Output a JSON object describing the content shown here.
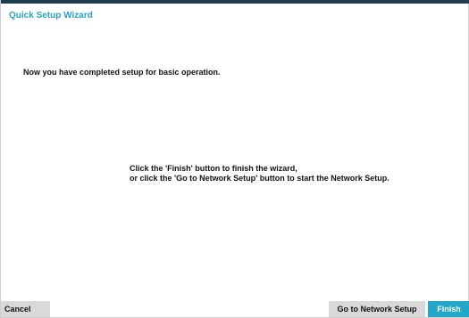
{
  "window": {
    "title": "Quick Setup Wizard"
  },
  "content": {
    "headline": "Now you have completed setup for basic operation.",
    "instruction_lines": [
      "Click the 'Finish' button to finish the wizard,",
      "or click the 'Go to Network Setup' button to start the Network Setup."
    ]
  },
  "footer": {
    "cancel_label": "Cancel",
    "network_setup_label": "Go to Network Setup",
    "finish_label": "Finish"
  },
  "colors": {
    "title": "#2b9fbf",
    "top_rule": "#1f3d4f",
    "finish_button": "#22a7c8",
    "secondary_button": "#d9d9d9"
  }
}
